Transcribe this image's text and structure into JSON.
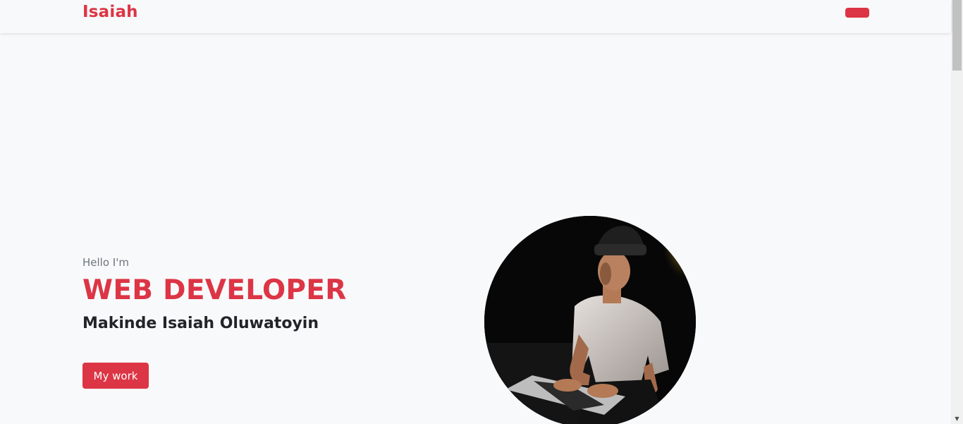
{
  "nav": {
    "brand": "Isaiah",
    "toggle_icon": "menu-toggle-icon"
  },
  "hero": {
    "greeting": "Hello I'm",
    "role": "WEB DEVELOPER",
    "name": "Makinde Isaiah Oluwatoyin",
    "cta_label": "My work",
    "portrait_icon": "portrait-photo"
  },
  "colors": {
    "accent": "#dc3545",
    "background": "#f8f9fa",
    "text_dark": "#212529",
    "text_muted": "#6c757d"
  },
  "scrollbar": {
    "down_arrow": "▼"
  }
}
